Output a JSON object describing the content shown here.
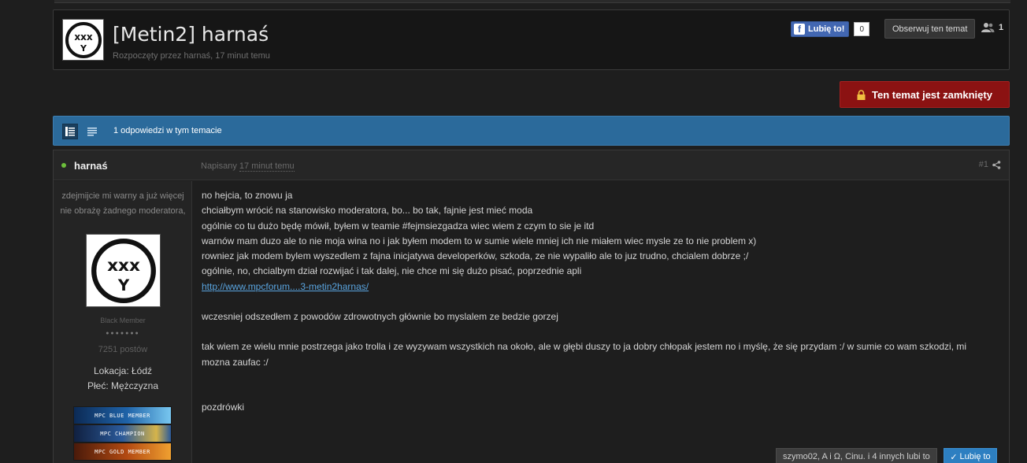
{
  "topic": {
    "title": "[Metin2] harnaś",
    "started_by": "Rozpoczęty przez harnaś, 17 minut temu",
    "fb_like_label": "Lubię to!",
    "fb_like_count": "0",
    "follow_label": "Obserwuj ten temat",
    "followers_count": "1",
    "locked_label": "Ten temat jest zamknięty"
  },
  "bar": {
    "reply_count": "1 odpowiedzi w tym temacie"
  },
  "post": {
    "author": "harnaś",
    "posted_label": "Napisany",
    "posted_time": "17 minut temu",
    "post_number": "#1",
    "author_title": "zdejmijcie mi warny a już więcej nie obrażę żadnego moderatora,",
    "group": "Black Member",
    "pips": "●●●●●●●",
    "post_count": "7251 postów",
    "location": "Lokacja: Łódź",
    "gender": "Płeć: Mężczyzna",
    "badges": [
      "MPC BLUE MEMBER",
      "MPC CHAMPION",
      "MPC GOLD MEMBER"
    ],
    "lines": [
      "no hejcia, to znowu ja",
      "chciałbym wrócić na stanowisko moderatora, bo... bo tak, fajnie jest mieć moda",
      "ogólnie co tu dużo będę mówił, byłem w teamie #fejmsiezgadza wiec wiem z czym to sie je itd",
      "warnów mam duzo ale to nie moja wina no i  jak byłem modem to w sumie wiele mniej ich nie miałem wiec mysle ze to nie problem x)",
      "rowniez jak modem bylem wyszedlem z fajna inicjatywa developerków, szkoda, ze nie wypaliło ale to juz trudno, chcialem dobrze ;/",
      "ogólnie, no, chcialbym dział rozwijać i tak dalej, nie chce mi się dużo pisać, poprzednie apli"
    ],
    "link": "http://www.mpcforum....3-metin2harnas/",
    "para2": "wczesniej odszedłem z powodów zdrowotnych głównie bo myslalem ze bedzie gorzej",
    "para3_line1": "tak wiem ze wielu mnie postrzega jako trolla i ze wyzywam wszystkich na około, ale w głębi duszy to ja dobry chłopak jestem no i myślę, że się przydam :/ w sumie co wam szkodzi, mi",
    "para3_line2": "mozna zaufac :/",
    "closing": "pozdrówki",
    "likes_text": "szymo02, A i Ω, Cinu. i 4 innych lubi to",
    "like_button": "Lubię to"
  },
  "colors": {
    "background": "#1e1e1e",
    "bluebar": "#2b6a9b",
    "locked": "#8b1212",
    "like_button": "#2d7fc1",
    "facebook": "#4267b2",
    "link": "#5aa5e0",
    "online": "#6cbf3b"
  }
}
